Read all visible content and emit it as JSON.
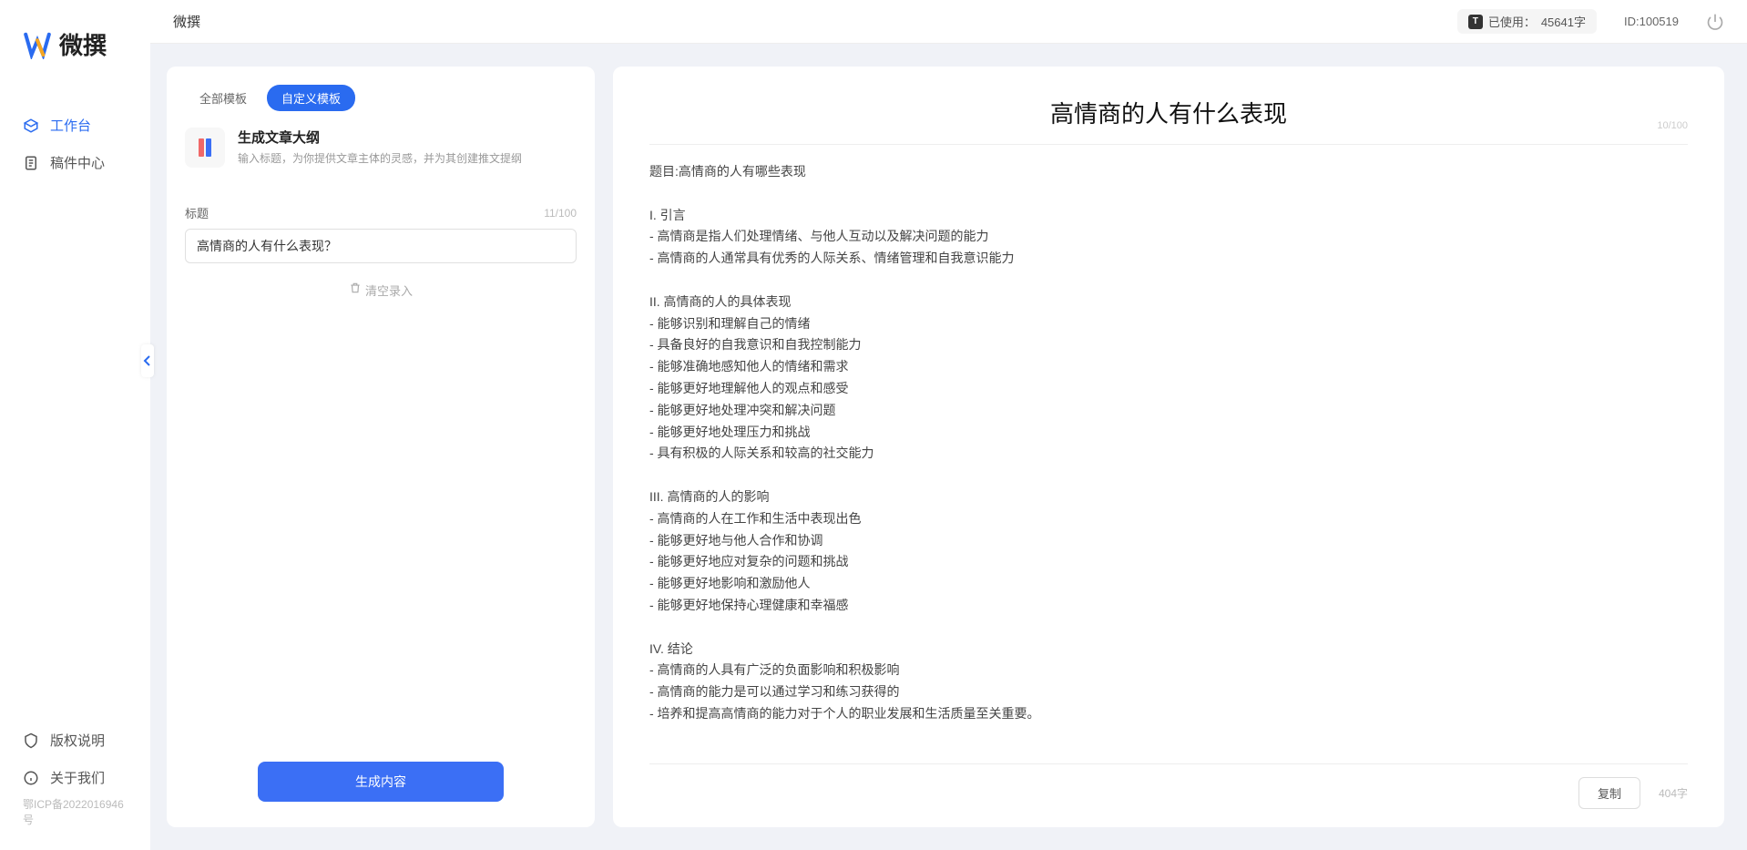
{
  "app_name": "微撰",
  "topbar": {
    "usage_prefix": "已使用：",
    "usage_value": "45641字",
    "id_prefix": "ID:",
    "id_value": "100519"
  },
  "sidebar": {
    "nav": [
      {
        "label": "工作台",
        "icon": "workspace"
      },
      {
        "label": "稿件中心",
        "icon": "docs"
      }
    ],
    "bottom": [
      {
        "label": "版权说明",
        "icon": "copyright"
      },
      {
        "label": "关于我们",
        "icon": "about"
      }
    ],
    "icp": "鄂ICP备2022016946号"
  },
  "tabs": {
    "all": "全部模板",
    "custom": "自定义模板"
  },
  "template": {
    "title": "生成文章大纲",
    "desc": "输入标题，为你提供文章主体的灵感，并为其创建推文提纲"
  },
  "field": {
    "label": "标题",
    "count": "11/100",
    "value": "高情商的人有什么表现？"
  },
  "clear_label": "清空录入",
  "generate_label": "生成内容",
  "result": {
    "title": "高情商的人有什么表现",
    "header_limit": "10/100",
    "body": "题目:高情商的人有哪些表现\n\nI. 引言\n- 高情商是指人们处理情绪、与他人互动以及解决问题的能力\n- 高情商的人通常具有优秀的人际关系、情绪管理和自我意识能力\n\nII. 高情商的人的具体表现\n- 能够识别和理解自己的情绪\n- 具备良好的自我意识和自我控制能力\n- 能够准确地感知他人的情绪和需求\n- 能够更好地理解他人的观点和感受\n- 能够更好地处理冲突和解决问题\n- 能够更好地处理压力和挑战\n- 具有积极的人际关系和较高的社交能力\n\nIII. 高情商的人的影响\n- 高情商的人在工作和生活中表现出色\n- 能够更好地与他人合作和协调\n- 能够更好地应对复杂的问题和挑战\n- 能够更好地影响和激励他人\n- 能够更好地保持心理健康和幸福感\n\nIV. 结论\n- 高情商的人具有广泛的负面影响和积极影响\n- 高情商的能力是可以通过学习和练习获得的\n- 培养和提高高情商的能力对于个人的职业发展和生活质量至关重要。",
    "copy_label": "复制",
    "char_count": "404字"
  }
}
